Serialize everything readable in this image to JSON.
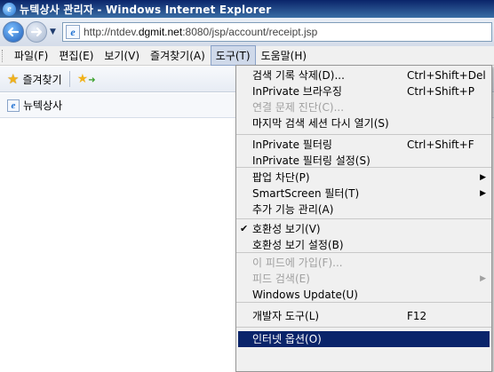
{
  "window": {
    "title": "뉴텍상사 관리자 - Windows Internet Explorer"
  },
  "address": {
    "url_prefix": "http://ntdev.",
    "url_host": "dgmit.net",
    "url_rest": ":8080/jsp/account/receipt.jsp"
  },
  "menubar": {
    "items": [
      {
        "label": "파일(F)"
      },
      {
        "label": "편집(E)"
      },
      {
        "label": "보기(V)"
      },
      {
        "label": "즐겨찾기(A)"
      },
      {
        "label": "도구(T)"
      },
      {
        "label": "도움말(H)"
      }
    ]
  },
  "favorites": {
    "label": "즐겨찾기"
  },
  "tab": {
    "title": "뉴텍상사"
  },
  "tools_menu": {
    "group1": [
      {
        "label": "검색 기록 삭제(D)...",
        "shortcut": "Ctrl+Shift+Del"
      },
      {
        "label": "InPrivate 브라우징",
        "shortcut": "Ctrl+Shift+P"
      },
      {
        "label": "연결 문제 진단(C)..."
      },
      {
        "label": "마지막 검색 세션 다시 열기(S)"
      }
    ],
    "group2": [
      {
        "label": "InPrivate 필터링",
        "shortcut": "Ctrl+Shift+F"
      },
      {
        "label": "InPrivate 필터링 설정(S)"
      }
    ],
    "group3": [
      {
        "label": "팝업 차단(P)"
      },
      {
        "label": "SmartScreen 필터(T)"
      },
      {
        "label": "추가 기능 관리(A)"
      }
    ],
    "group4": [
      {
        "label": "호환성 보기(V)"
      },
      {
        "label": "호환성 보기 설정(B)"
      }
    ],
    "group5": [
      {
        "label": "이 피드에 가입(F)..."
      },
      {
        "label": "피드 검색(E)"
      },
      {
        "label": "Windows Update(U)"
      }
    ],
    "group6": [
      {
        "label": "개발자 도구(L)",
        "shortcut": "F12"
      }
    ],
    "group7": [
      {
        "label": "인터넷 옵션(O)"
      }
    ]
  }
}
